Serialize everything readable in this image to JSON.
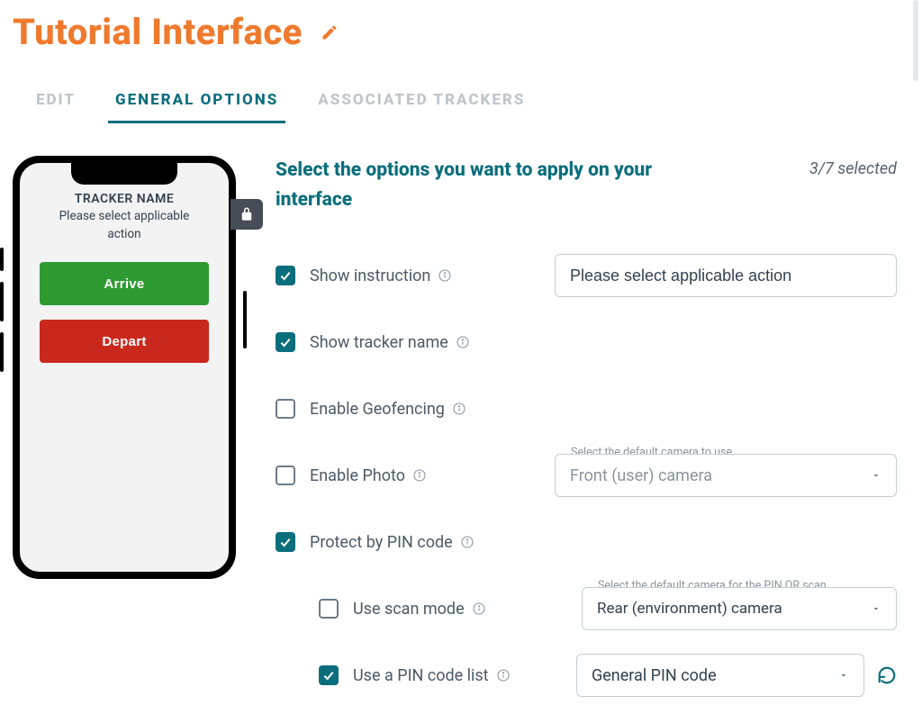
{
  "title": "Tutorial Interface",
  "tabs": {
    "edit": "EDIT",
    "general_options": "GENERAL OPTIONS",
    "associated_trackers": "ASSOCIATED TRACKERS"
  },
  "phone_preview": {
    "tracker_name": "TRACKER NAME",
    "instruction_line1": "Please select applicable",
    "instruction_line2": "action",
    "arrive_label": "Arrive",
    "depart_label": "Depart"
  },
  "section": {
    "title": "Select the options you want to apply on your interface",
    "selected_count": "3/7 selected"
  },
  "options": {
    "show_instruction": {
      "label": "Show instruction",
      "checked": true,
      "value": "Please select applicable action"
    },
    "show_tracker_name": {
      "label": "Show tracker name",
      "checked": true
    },
    "enable_geofencing": {
      "label": "Enable Geofencing",
      "checked": false
    },
    "enable_photo": {
      "label": "Enable Photo",
      "checked": false,
      "camera_select": {
        "float_label": "Select the default camera to use",
        "value": "Front (user) camera"
      }
    },
    "protect_pin": {
      "label": "Protect by PIN code",
      "checked": true
    },
    "use_scan_mode": {
      "label": "Use scan mode",
      "checked": false,
      "camera_select": {
        "float_label": "Select the default camera for the PIN QR scan …",
        "value": "Rear (environment) camera"
      }
    },
    "use_pin_list": {
      "label": "Use a PIN code list",
      "checked": true,
      "list_select": {
        "value": "General PIN code"
      }
    }
  }
}
